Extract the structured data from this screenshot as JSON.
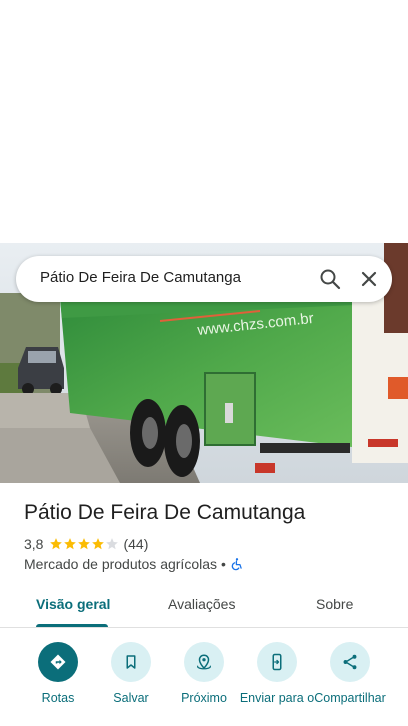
{
  "search": {
    "query": "Pátio De Feira De Camutanga"
  },
  "photo": {
    "truck_text": "www.chzs.com.br"
  },
  "place": {
    "title": "Pátio De Feira De Camutanga",
    "rating": "3,8",
    "stars": 3.8,
    "review_count": "(44)",
    "category": "Mercado de produtos agrícolas",
    "separator": "•"
  },
  "tabs": [
    {
      "label": "Visão geral",
      "active": true
    },
    {
      "label": "Avaliações",
      "active": false
    },
    {
      "label": "Sobre",
      "active": false
    }
  ],
  "actions": [
    {
      "label": "Rotas",
      "icon": "directions-icon"
    },
    {
      "label": "Salvar",
      "icon": "bookmark-icon"
    },
    {
      "label": "Próximo",
      "icon": "nearby-icon"
    },
    {
      "label": "Enviar para o",
      "icon": "send-to-phone-icon"
    },
    {
      "label": "Compartilhar",
      "icon": "share-icon"
    }
  ],
  "colors": {
    "accent": "#0b6e7a",
    "star": "#fbbc04",
    "action_bg": "#d9f0f3"
  }
}
